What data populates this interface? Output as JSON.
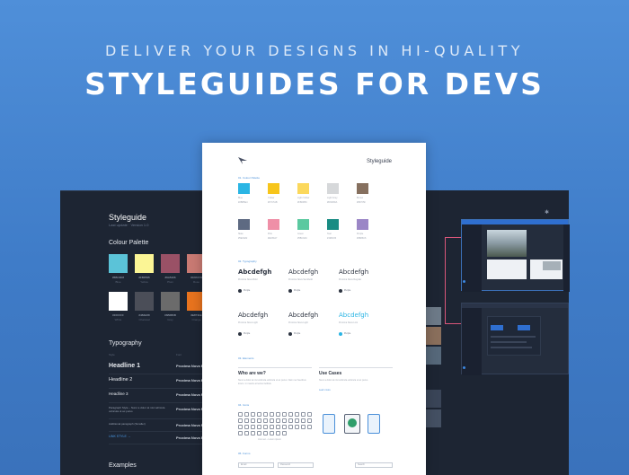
{
  "hero": {
    "subtitle": "DELIVER YOUR DESIGNS IN HI-QUALITY",
    "title": "STYLEGUIDES FOR DEVS"
  },
  "left_panel": {
    "title": "Styleguide",
    "subtitle": "Last update · Version 1.0",
    "colour_heading": "Colour Palette",
    "swatches": [
      {
        "color": "#5bc3d8",
        "code": "#5BC3D8",
        "name": "Blue"
      },
      {
        "color": "#fbf595",
        "code": "#FBF595",
        "name": "Yellow"
      },
      {
        "color": "#9a5166",
        "code": "#9A5166",
        "name": "Plum"
      },
      {
        "color": "#c97a73",
        "code": "#C97A73",
        "name": "Rose"
      },
      {
        "color": "#ffffff",
        "code": "#FFFFFF",
        "name": "White"
      },
      {
        "color": "#4b4e58",
        "code": "#4B4E58",
        "name": "Charcoal"
      },
      {
        "color": "#6b6b6b",
        "code": "#6B6B6B",
        "name": "Grey"
      },
      {
        "color": "#e8731e",
        "code": "#E8731E",
        "name": "Orange"
      }
    ],
    "typography_heading": "Typography",
    "typography_cols": [
      "Style",
      "Font"
    ],
    "typography": [
      {
        "label": "Headline 1",
        "font": "Proxima Nova Bold"
      },
      {
        "label": "Headline 2",
        "font": "Proxima Nova Bold"
      },
      {
        "label": "Headline 3",
        "font": "Proxima Nova Regular"
      },
      {
        "label": "Paragraph Style – Nunc a dolor at nisi vehicula vehicula ut ac purus",
        "font": "Proxima Nova Regular"
      },
      {
        "label": "Additional paragraph (Smaller)",
        "font": "Proxima Nova Regular"
      },
      {
        "label": "LINK STYLE →",
        "font": "Proxima Nova Bold"
      }
    ],
    "examples_heading": "Examples"
  },
  "paper": {
    "title": "Styleguide",
    "colours_label": "01. Colour Palette",
    "swatch_row1": [
      {
        "color": "#2bb5e4",
        "name": "Blue",
        "hex": "#2BB5E4"
      },
      {
        "color": "#f7c51b",
        "name": "Yellow",
        "hex": "#F7C51B"
      },
      {
        "color": "#fbd85c",
        "name": "Light Yellow",
        "hex": "#FBD85C"
      },
      {
        "color": "#d6d8da",
        "name": "Light Grey",
        "hex": "#D6D8DA"
      },
      {
        "color": "#86705f",
        "name": "Brown",
        "hex": "#86705F"
      }
    ],
    "swatch_row2": [
      {
        "color": "#5e6a82",
        "name": "Slate",
        "hex": "#5E6A82"
      },
      {
        "color": "#ef8fa7",
        "name": "Pink",
        "hex": "#EF8FA7"
      },
      {
        "color": "#5bc9a0",
        "name": "Green",
        "hex": "#5BC9A0"
      },
      {
        "color": "#198c83",
        "name": "Teal",
        "hex": "#198C83"
      },
      {
        "color": "#9b86c6",
        "name": "Purple",
        "hex": "#9B86C6"
      }
    ],
    "typography_label": "02. Typography",
    "typefaces": [
      {
        "sample": "Abcdefgh",
        "name": "Proxima Nova Bold"
      },
      {
        "sample": "Abcdefgh",
        "name": "Proxima Nova Semibold"
      },
      {
        "sample": "Abcdefgh",
        "name": "Proxima Nova Regular"
      },
      {
        "sample": "Abcdefgh",
        "name": "Proxima Nova Light"
      },
      {
        "sample": "Abcdefgh",
        "name": "Proxima Nova Light"
      },
      {
        "sample": "Abcdefgh",
        "name": "Proxima Nova Link"
      }
    ],
    "bullet_label": "Purple",
    "elements_label": "03. Elements",
    "card1_title": "Who are we?",
    "card1_text": "Nunc a dolor at nisi vehicula vehicula ut ac purus. Nam nec faucibus lorem. In mauris at lectus facilisis.",
    "card2_title": "Use Cases",
    "card2_text": "Nunc a dolor at nisi vehicula vehicula ut ac purus.",
    "card2_link": "Learn more",
    "icons_label": "04. Icons",
    "icon_caption": "Icon set – Lorem ipsum",
    "forms_label": "05. Forms",
    "inputs": [
      "Email",
      "Password",
      "Search"
    ]
  },
  "colors": {
    "accent": "#4a90d9",
    "dark": "#1d2533"
  }
}
